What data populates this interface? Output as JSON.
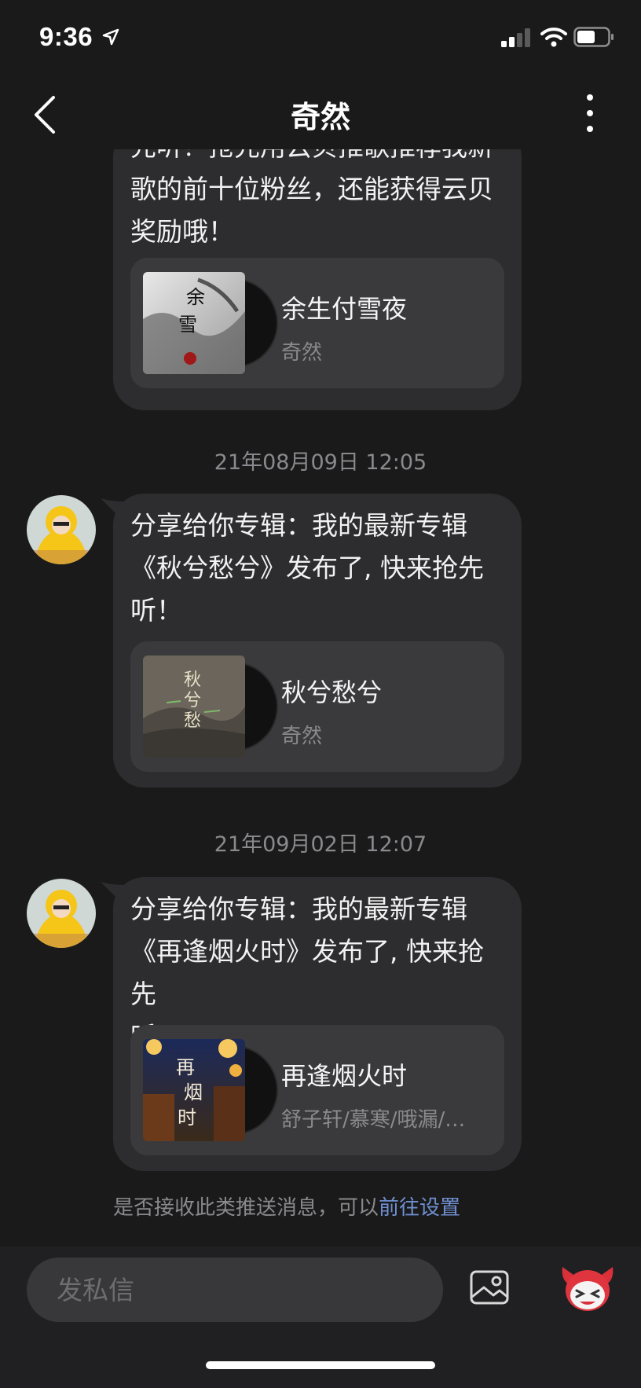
{
  "status_bar": {
    "time": "9:36"
  },
  "header": {
    "title": "奇然"
  },
  "messages": [
    {
      "text": "先听！抢先用云贝推歌推荐我新\n歌的前十位粉丝，还能获得云贝\n奖励哦！",
      "card": {
        "title": "余生付雪夜",
        "artist": "奇然"
      }
    },
    {
      "timestamp": "21年08月09日 12:05",
      "text": "分享给你专辑：我的最新专辑\n《秋兮愁兮》发布了, 快来抢先\n听！",
      "card": {
        "title": "秋兮愁兮",
        "artist": "奇然"
      }
    },
    {
      "timestamp": "21年09月02日 12:07",
      "text": "分享给你专辑：我的最新专辑\n《再逢烟火时》发布了, 快来抢先\n听！",
      "card": {
        "title": "再逢烟火时",
        "artist": "舒子轩/慕寒/哦漏/…"
      }
    }
  ],
  "notice": {
    "text": "是否接收此类推送消息，可以",
    "link": "前往设置"
  },
  "composer": {
    "placeholder": "发私信"
  },
  "icons": {
    "back": "chevron-left-icon",
    "more": "more-vertical-icon",
    "image": "image-icon",
    "emoji": "emoji-mascot-icon"
  },
  "colors": {
    "background": "#1a1a1a",
    "bubble": "#2d2d2f",
    "card": "#3a3a3c",
    "link": "#6f8fd0",
    "muted": "#8a8a8e"
  }
}
